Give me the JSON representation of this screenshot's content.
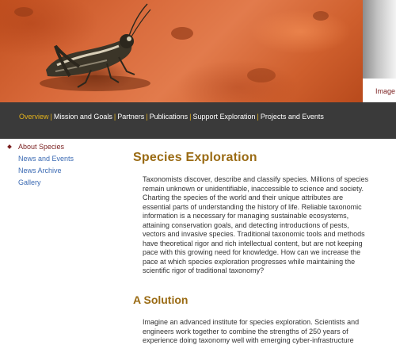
{
  "banner": {
    "image_credit": "Image l"
  },
  "nav": {
    "items": [
      {
        "label": "Overview",
        "active": true
      },
      {
        "label": "Mission and Goals",
        "active": false
      },
      {
        "label": "Partners",
        "active": false
      },
      {
        "label": "Publications",
        "active": false
      },
      {
        "label": "Support Exploration",
        "active": false
      },
      {
        "label": "Projects and Events",
        "active": false
      }
    ],
    "separator": "|"
  },
  "sidebar": {
    "items": [
      {
        "label": "About Species",
        "active": true
      },
      {
        "label": "News and Events",
        "active": false
      },
      {
        "label": "News Archive",
        "active": false
      },
      {
        "label": "Gallery",
        "active": false
      }
    ]
  },
  "main": {
    "title": "Species Exploration",
    "intro": "Taxonomists discover, describe and classify species. Millions of species remain unknown or unidentifiable, inaccessible to science and society. Charting the species of the world and their unique attributes are essential parts of understanding the history of life. Reliable taxonomic information is a necessary for managing sustainable ecosystems, attaining conservation goals, and detecting introductions of pests, vectors and invasive species. Traditional taxonomic tools and methods have theoretical rigor and rich intellectual content, but are not keeping pace with this growing need for knowledge. How can we increase the pace at which species exploration progresses while maintaining the scientific rigor of traditional taxonomy?",
    "subtitle": "A Solution",
    "solution": "Imagine an advanced institute for species exploration. Scientists and engineers work together to combine the strengths of 250 years of experience doing taxonomy well with emerging cyber-infrastructure"
  },
  "colors": {
    "nav_bg": "#3a3a3a",
    "accent_gold": "#e3b21d",
    "heading": "#9a6b14",
    "link_blue": "#3b6ab3",
    "active_red": "#7a1f1f"
  }
}
